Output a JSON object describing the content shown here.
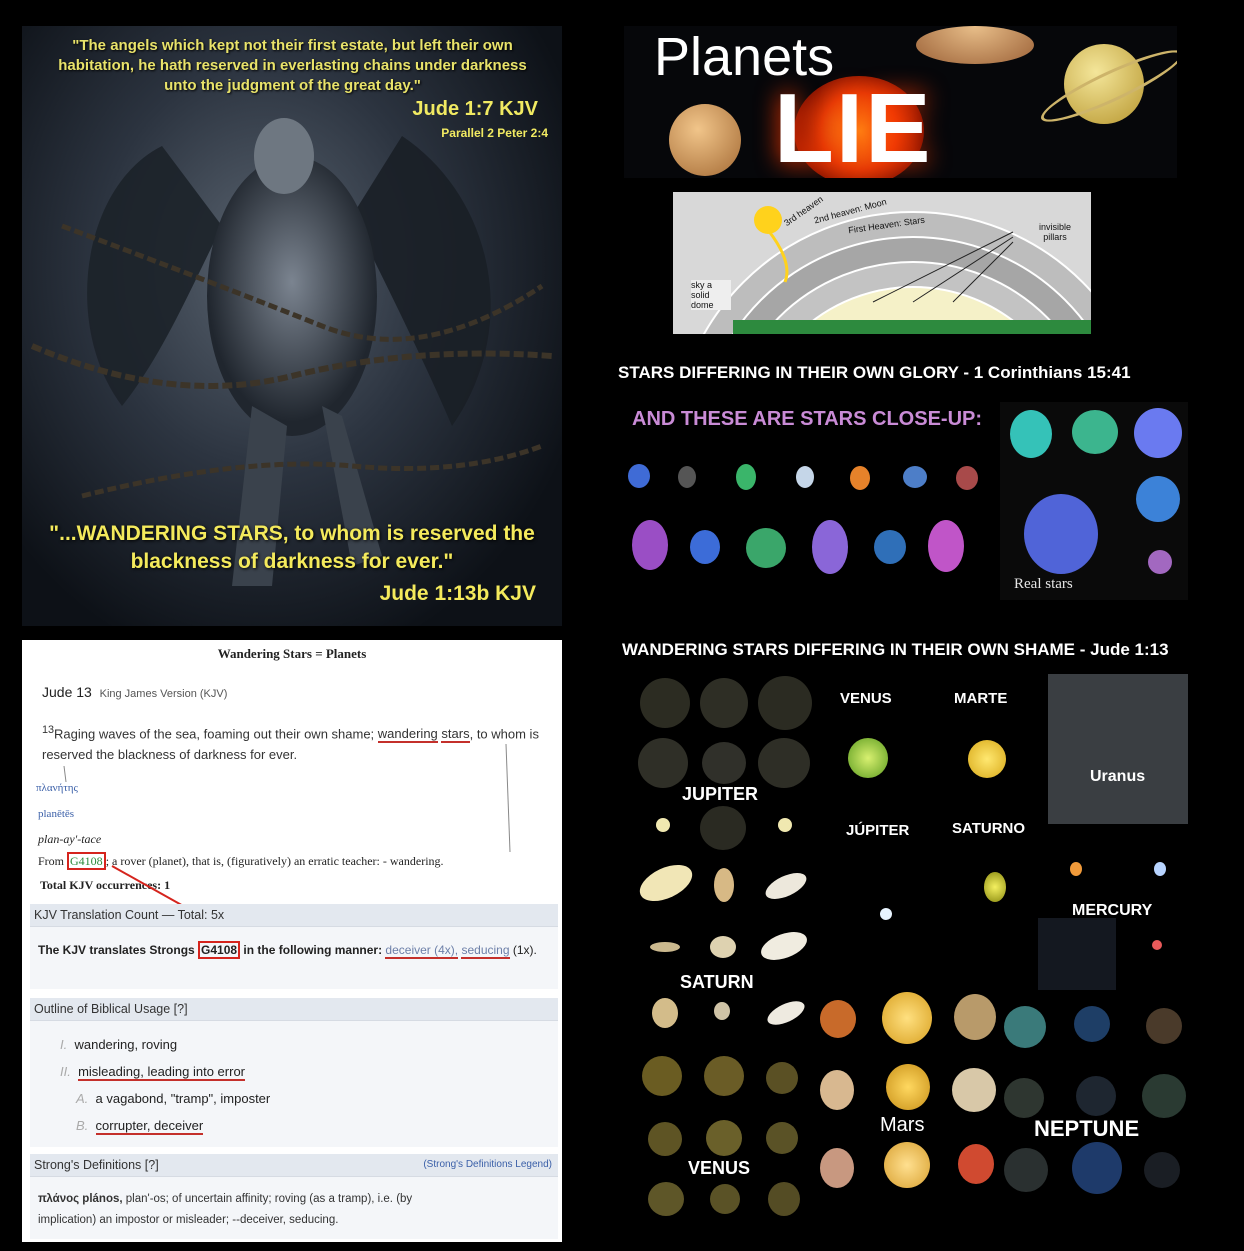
{
  "angel_panel": {
    "quote": "\"The angels which kept not their first estate, but left their own habitation, he hath reserved in everlasting chains under darkness unto the judgment of the great day.\"",
    "ref1": "Jude 1:7 KJV",
    "ref2": "Parallel 2 Peter 2:4",
    "big_quote": "\"...WANDERING STARS, to whom is reserved the blackness of darkness for ever.\"",
    "ref3": "Jude 1:13b KJV"
  },
  "planets_lie": {
    "word1": "Planets",
    "word2": "LIE"
  },
  "dome_diagram": {
    "labels": [
      "3rd heaven",
      "2nd heaven: Moon",
      "First Heaven: Stars",
      "invisible pillars",
      "sky a solid dome"
    ]
  },
  "glory_heading": "STARS DIFFERING IN THEIR OWN GLORY - 1 Corinthians 15:41",
  "closeup_heading": "AND THESE ARE STARS CLOSE-UP:",
  "real_stars": "Real stars",
  "wander_heading": "WANDERING STARS DIFFERING IN THEIR OWN SHAME - Jude 1:13",
  "planet_labels": {
    "jupiter1": "JUPITER",
    "venus_es": "VENUS",
    "marte": "MARTE",
    "uranus": "Uranus",
    "jupiter_es": "JÚPITER",
    "saturno": "SATURNO",
    "mercury": "MERCURY",
    "saturn": "SATURN",
    "mars": "Mars",
    "neptune": "NEPTUNE",
    "venus": "VENUS"
  },
  "doc": {
    "title": "Wandering Stars = Planets",
    "verse_ref": "Jude 13",
    "version": "King James Version (KJV)",
    "verse_num": "13",
    "verse_a": "Raging waves of the sea, foaming out their own shame; ",
    "verse_u1": "wandering",
    "verse_u2": "stars",
    "verse_b": ", to whom is reserved the blackness of darkness for ever.",
    "greek": "πλανήτης",
    "translit": "planētēs",
    "pron": "plan-ay'-tace",
    "from_a": "From ",
    "from_link": "G4108",
    "from_b": "; a rover (planet), that is, (figuratively) an erratic teacher: - wandering.",
    "total": "Total KJV occurrences: 1",
    "trans_hd": "KJV Translation Count — Total: 5x",
    "trans_a": "The KJV translates Strongs ",
    "trans_code": "G4108",
    "trans_b": " in the following manner: ",
    "trans_c": "deceiver (4x),",
    "trans_d": "seducing",
    "trans_e": " (1x).",
    "outline_hd": "Outline of Biblical Usage [?]",
    "outline": [
      {
        "n": "I.",
        "t": "wandering, roving"
      },
      {
        "n": "II.",
        "t": "misleading, leading into error"
      },
      {
        "n": "A.",
        "t": "a vagabond, \"tramp\", imposter"
      },
      {
        "n": "B.",
        "t": "corrupter, deceiver"
      }
    ],
    "strongs_hd": "Strong's Definitions [?]",
    "strongs_legend": "(Strong's Definitions Legend)",
    "def_word": "πλάνος plános,",
    "def_a": " plan'-os; of uncertain affinity; roving (as a tramp), i.e. (by",
    "def_b": "implication) an impostor or misleader; --deceiver, seducing."
  }
}
